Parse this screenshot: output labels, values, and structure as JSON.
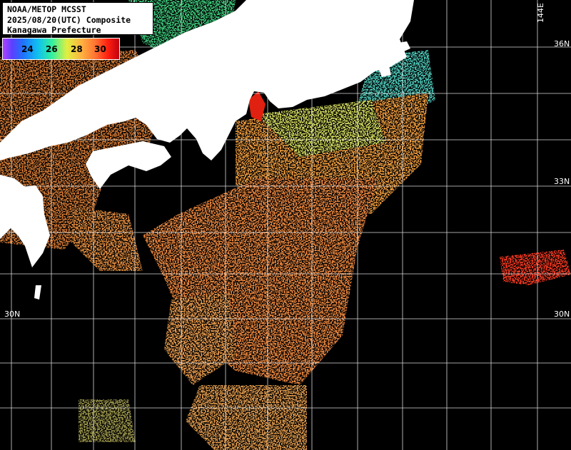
{
  "title": {
    "line1": "NOAA/METOP MCSST",
    "line2": "2025/08/20(UTC) Composite",
    "line3": "Kanagawa Prefecture"
  },
  "color_scale": {
    "labels": [
      "24",
      "26",
      "28",
      "30"
    ],
    "colors": [
      "#b040ff",
      "#2070ff",
      "#10c0f0",
      "#30f0a0",
      "#e0f040",
      "#ffb040",
      "#ff7030",
      "#ff2010",
      "#c00010"
    ]
  },
  "lat_labels": {
    "lat36": "36N",
    "lat33": "33N",
    "lat30_left": "30N",
    "lat30_right": "30N"
  },
  "lon_labels": {
    "lon144": "144E"
  },
  "colors": {
    "ocean_nodata": "#000000",
    "land": "#ffffff",
    "grid": "#ffffff"
  }
}
